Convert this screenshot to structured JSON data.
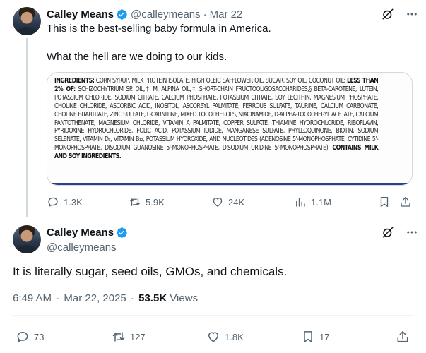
{
  "tweet1": {
    "author_name": "Calley Means",
    "handle": "@calleymeans",
    "date": "Mar 22",
    "separator": "·",
    "line1": "This is the best-selling baby formula in America.",
    "line2": "What the hell are we doing to our kids.",
    "image_label": {
      "ingredients_heading": "INGREDIENTS:",
      "ingredients_part1": " CORN SYRUP, MILK PROTEIN ISOLATE, HIGH OLEIC SAFFLOWER OIL, SUGAR, SOY OIL, COCONUT OIL; ",
      "less_than": "LESS THAN 2% OF:",
      "ingredients_part2": " SCHIZOCHYTRIUM SP. OIL,† M. ALPINA OIL,‡ SHORT-CHAIN FRUCTOOLIGOSACCHARIDES,§ BETA-CAROTENE, LUTEIN, POTASSIUM CHLORIDE, SODIUM CITRATE, CALCIUM PHOSPHATE, POTASSIUM CITRATE, SOY LECITHIN, MAGNESIUM PHOSPHATE, CHOLINE CHLORIDE, ASCORBIC ACID, INOSITOL, ASCORBYL PALMITATE, FERROUS SULFATE, TAURINE, CALCIUM CARBONATE, CHOLINE BITARTRATE, ZINC SULFATE, L-CARNITINE, MIXED TOCOPHEROLS, NIACINAMIDE, d-ALPHA-TOCOPHERYL ACETATE, CALCIUM PANTOTHENATE, MAGNESIUM CHLORIDE, VITAMIN A PALMITATE, COPPER SULFATE, THIAMINE HYDROCHLORIDE, RIBOFLAVIN, PYRIDOXINE HYDROCHLORIDE, FOLIC ACID, POTASSIUM IODIDE, MANGANESE SULFATE, PHYLLOQUINONE, BIOTIN, SODIUM SELENATE, VITAMIN D₃, VITAMIN B₁₂, POTASSIUM HYDROXIDE, AND NUCLEOTIDES (ADENOSINE 5'-MONOPHOSPHATE, CYTIDINE 5'-MONOPHOSPHATE, DISODIUM GUANOSINE 5'-MONOPHOSPHATE, DISODIUM URIDINE 5'-MONOPHOSPHATE). ",
      "contains": "CONTAINS MILK AND SOY INGREDIENTS."
    },
    "replies": "1.3K",
    "reposts": "5.9K",
    "likes": "24K",
    "views": "1.1M"
  },
  "tweet2": {
    "author_name": "Calley Means",
    "handle": "@calleymeans",
    "text": "It is literally sugar, seed oils, GMOs, and chemicals.",
    "time": "6:49 AM",
    "date": "Mar 22, 2025",
    "separator": "·",
    "views_count": "53.5K",
    "views_label": "Views",
    "replies": "73",
    "reposts": "127",
    "likes": "1.8K",
    "bookmarks": "17"
  },
  "colors": {
    "text_primary": "#0f1419",
    "text_secondary": "#536471",
    "verified_blue": "#1d9bf0",
    "divider": "#eff3f4"
  }
}
